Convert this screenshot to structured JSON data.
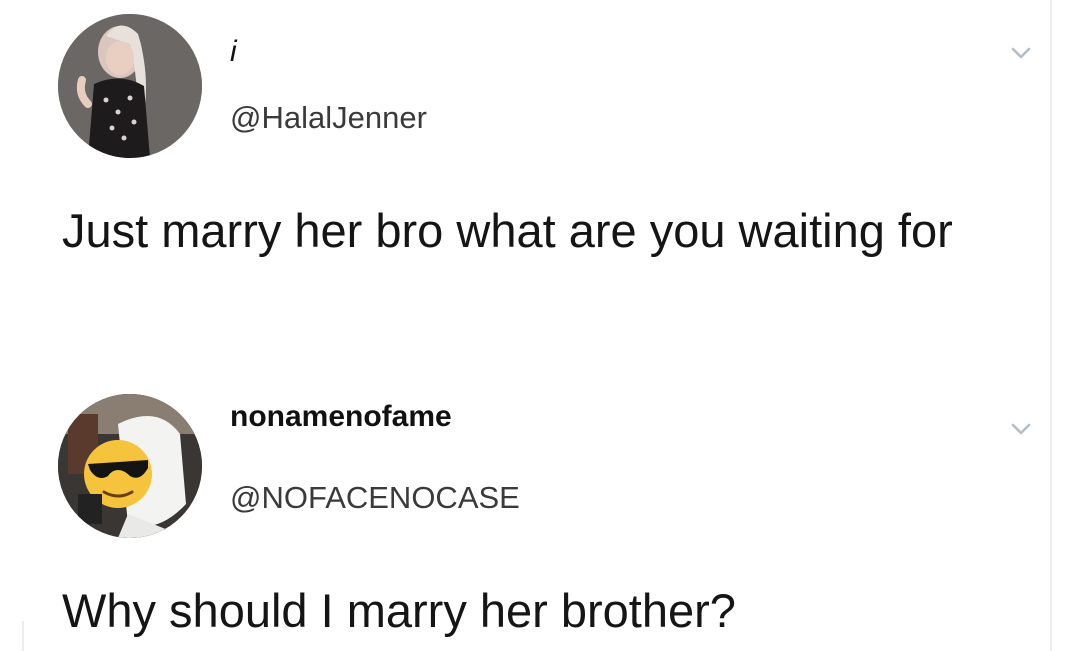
{
  "tweets": [
    {
      "display_name": "i",
      "handle": "@HalalJenner",
      "text": "Just marry her bro what are you waiting for",
      "avatar_icon": "avatar-woman-photo",
      "menu_icon": "chevron-down-icon"
    },
    {
      "display_name": "nonamenofame",
      "handle": "@NOFACENOCASE",
      "text": "Why should I marry her brother?",
      "avatar_icon": "avatar-sunglasses-emoji-photo",
      "menu_icon": "chevron-down-icon"
    }
  ],
  "colors": {
    "background": "#ffffff",
    "text": "#151515",
    "handle": "#3a3a3a",
    "chevron": "#b5bec5"
  }
}
